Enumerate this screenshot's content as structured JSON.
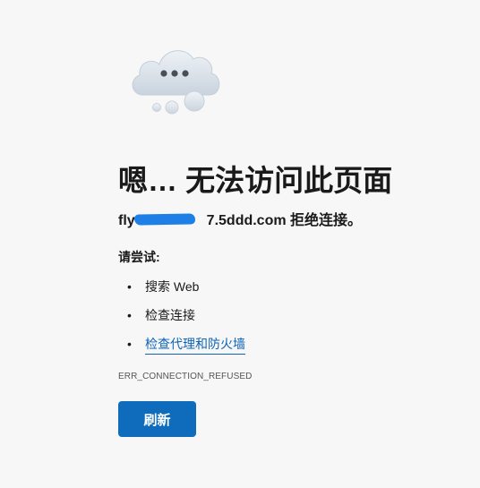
{
  "error_page": {
    "icon": "cloud-with-ellipsis-icon",
    "headline": "嗯… 无法访问此页面",
    "host_prefix": "fly",
    "host_suffix": "7.5ddd.com",
    "refused_message": " 拒绝连接。",
    "try_label": "请尝试:",
    "suggestions": [
      {
        "label": "搜索 Web",
        "link": false
      },
      {
        "label": "检查连接",
        "link": false
      },
      {
        "label": "检查代理和防火墙",
        "link": true
      }
    ],
    "bullet": "•",
    "error_code": "ERR_CONNECTION_REFUSED",
    "refresh_label": "刷新"
  },
  "colors": {
    "background": "#f7f7f7",
    "accent": "#0f6cbd",
    "link": "#0e63b5",
    "redaction": "#1e7fe6"
  }
}
